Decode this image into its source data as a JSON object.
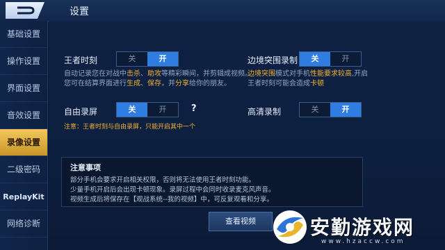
{
  "header": {
    "title": "设置"
  },
  "sidebar": {
    "items": [
      {
        "label": "基础设置"
      },
      {
        "label": "操作设置"
      },
      {
        "label": "界面设置"
      },
      {
        "label": "音效设置"
      },
      {
        "label": "录像设置"
      },
      {
        "label": "二级密码"
      },
      {
        "label": "ReplayKit"
      },
      {
        "label": "网络诊断"
      }
    ],
    "active_index": 4
  },
  "settings": {
    "king_moment": {
      "label": "王者时刻",
      "off": "关",
      "on": "开",
      "state": "on",
      "desc_1a": "自动记录您在对战中",
      "desc_1b": "击杀",
      "desc_1c": "、",
      "desc_1d": "助攻",
      "desc_1e": "等精彩瞬间，并剪辑成视频。",
      "desc_2a": "您可在结算界面进行",
      "desc_2b": "生成",
      "desc_2c": "、",
      "desc_2d": "保存",
      "desc_2e": "，并",
      "desc_2f": "分享",
      "desc_2g": "给你的朋友。"
    },
    "border_record": {
      "label": "边境突围录制",
      "off": "关",
      "on": "开",
      "state": "off",
      "desc_1a": "边境突围",
      "desc_1b": "模式对手机",
      "desc_1c": "性能要求较高",
      "desc_1d": ",开启",
      "desc_2a": "王者时刻可能会造成",
      "desc_2b": "卡顿"
    },
    "free_record": {
      "label": "自由录屏",
      "off": "关",
      "on": "开",
      "state": "off",
      "help": "?",
      "note": "注意：王者时刻与自由录屏，只能开启其中一个"
    },
    "hd_record": {
      "label": "高清录制",
      "off": "关",
      "on": "开",
      "state": "on"
    }
  },
  "notice": {
    "title": "注意事项",
    "lines": [
      "部分手机会要求开启相关权限，否则将无法使用王者时刻功能。",
      "少量手机开启后会出现卡顿现象。录屏过程中会同时收录麦克风声音。",
      "视频生成后将保存在【观战系统--我的视频】中，可反复观看和分享。"
    ]
  },
  "buttons": {
    "watch_video": "查看视频"
  },
  "watermark": {
    "name": "安勤游戏网",
    "url": "www.hzaccw.com"
  },
  "colors": {
    "accent": "#2f7de0",
    "highlight": "#f2b233",
    "active_tab": "#e0ad3e"
  }
}
